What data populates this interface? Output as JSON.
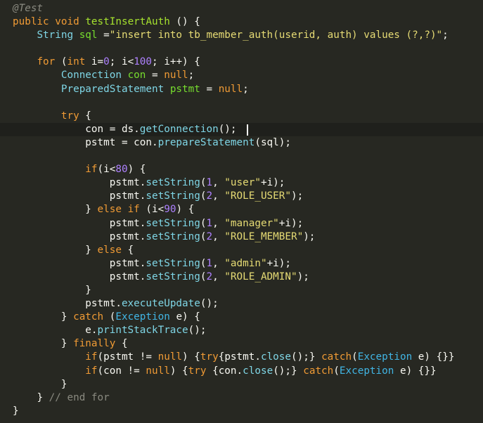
{
  "editor": {
    "lines": [
      [
        {
          "t": "@Test",
          "c": "c-anno"
        }
      ],
      [
        {
          "t": "public",
          "c": "c-kw"
        },
        {
          "t": " ",
          "c": "c-op"
        },
        {
          "t": "void",
          "c": "c-kw"
        },
        {
          "t": " ",
          "c": "c-op"
        },
        {
          "t": "testInsertAuth",
          "c": "c-methodname"
        },
        {
          "t": " () {",
          "c": "c-op"
        }
      ],
      [
        {
          "t": "    ",
          "c": "c-op"
        },
        {
          "t": "String",
          "c": "c-classname"
        },
        {
          "t": " ",
          "c": "c-op"
        },
        {
          "t": "sql",
          "c": "c-type"
        },
        {
          "t": " =",
          "c": "c-op"
        },
        {
          "t": "\"insert into tb_member_auth(userid, auth) values (?,?)\"",
          "c": "c-string"
        },
        {
          "t": ";",
          "c": "c-op"
        }
      ],
      [],
      [
        {
          "t": "    ",
          "c": "c-op"
        },
        {
          "t": "for",
          "c": "c-kw"
        },
        {
          "t": " (",
          "c": "c-op"
        },
        {
          "t": "int",
          "c": "c-kw"
        },
        {
          "t": " ",
          "c": "c-op"
        },
        {
          "t": "i",
          "c": "c-var"
        },
        {
          "t": "=",
          "c": "c-op"
        },
        {
          "t": "0",
          "c": "c-number"
        },
        {
          "t": "; ",
          "c": "c-op"
        },
        {
          "t": "i",
          "c": "c-var"
        },
        {
          "t": "<",
          "c": "c-op"
        },
        {
          "t": "100",
          "c": "c-number"
        },
        {
          "t": "; ",
          "c": "c-op"
        },
        {
          "t": "i",
          "c": "c-var"
        },
        {
          "t": "++) {",
          "c": "c-op"
        }
      ],
      [
        {
          "t": "        ",
          "c": "c-op"
        },
        {
          "t": "Connection",
          "c": "c-classname"
        },
        {
          "t": " ",
          "c": "c-op"
        },
        {
          "t": "con",
          "c": "c-type"
        },
        {
          "t": " = ",
          "c": "c-op"
        },
        {
          "t": "null",
          "c": "c-kw"
        },
        {
          "t": ";",
          "c": "c-op"
        }
      ],
      [
        {
          "t": "        ",
          "c": "c-op"
        },
        {
          "t": "PreparedStatement",
          "c": "c-classname"
        },
        {
          "t": " ",
          "c": "c-op"
        },
        {
          "t": "pstmt",
          "c": "c-type"
        },
        {
          "t": " = ",
          "c": "c-op"
        },
        {
          "t": "null",
          "c": "c-kw"
        },
        {
          "t": ";",
          "c": "c-op"
        }
      ],
      [],
      [
        {
          "t": "        ",
          "c": "c-op"
        },
        {
          "t": "try",
          "c": "c-kw"
        },
        {
          "t": " {",
          "c": "c-op"
        }
      ],
      [
        {
          "t": "            ",
          "c": "c-op"
        },
        {
          "t": "con",
          "c": "c-var"
        },
        {
          "t": " = ",
          "c": "c-op"
        },
        {
          "t": "ds",
          "c": "c-var"
        },
        {
          "t": ".",
          "c": "c-op"
        },
        {
          "t": "getConnection",
          "c": "c-method"
        },
        {
          "t": "();",
          "c": "c-op"
        }
      ],
      [
        {
          "t": "            ",
          "c": "c-op"
        },
        {
          "t": "pstmt",
          "c": "c-var"
        },
        {
          "t": " = ",
          "c": "c-op"
        },
        {
          "t": "con",
          "c": "c-var"
        },
        {
          "t": ".",
          "c": "c-op"
        },
        {
          "t": "prepareStatement",
          "c": "c-method"
        },
        {
          "t": "(",
          "c": "c-op"
        },
        {
          "t": "sql",
          "c": "c-var"
        },
        {
          "t": ");",
          "c": "c-op"
        }
      ],
      [],
      [
        {
          "t": "            ",
          "c": "c-op"
        },
        {
          "t": "if",
          "c": "c-kw"
        },
        {
          "t": "(",
          "c": "c-op"
        },
        {
          "t": "i",
          "c": "c-var"
        },
        {
          "t": "<",
          "c": "c-op"
        },
        {
          "t": "80",
          "c": "c-number"
        },
        {
          "t": ") {",
          "c": "c-op"
        }
      ],
      [
        {
          "t": "                ",
          "c": "c-op"
        },
        {
          "t": "pstmt",
          "c": "c-var"
        },
        {
          "t": ".",
          "c": "c-op"
        },
        {
          "t": "setString",
          "c": "c-method"
        },
        {
          "t": "(",
          "c": "c-op"
        },
        {
          "t": "1",
          "c": "c-number"
        },
        {
          "t": ", ",
          "c": "c-op"
        },
        {
          "t": "\"user\"",
          "c": "c-string"
        },
        {
          "t": "+",
          "c": "c-op"
        },
        {
          "t": "i",
          "c": "c-var"
        },
        {
          "t": ");",
          "c": "c-op"
        }
      ],
      [
        {
          "t": "                ",
          "c": "c-op"
        },
        {
          "t": "pstmt",
          "c": "c-var"
        },
        {
          "t": ".",
          "c": "c-op"
        },
        {
          "t": "setString",
          "c": "c-method"
        },
        {
          "t": "(",
          "c": "c-op"
        },
        {
          "t": "2",
          "c": "c-number"
        },
        {
          "t": ", ",
          "c": "c-op"
        },
        {
          "t": "\"ROLE_USER\"",
          "c": "c-string"
        },
        {
          "t": ");",
          "c": "c-op"
        }
      ],
      [
        {
          "t": "            ",
          "c": "c-op"
        },
        {
          "t": "} ",
          "c": "c-op"
        },
        {
          "t": "else",
          "c": "c-kw"
        },
        {
          "t": " ",
          "c": "c-op"
        },
        {
          "t": "if",
          "c": "c-kw"
        },
        {
          "t": " (",
          "c": "c-op"
        },
        {
          "t": "i",
          "c": "c-var"
        },
        {
          "t": "<",
          "c": "c-op"
        },
        {
          "t": "90",
          "c": "c-number"
        },
        {
          "t": ") {",
          "c": "c-op"
        }
      ],
      [
        {
          "t": "                ",
          "c": "c-op"
        },
        {
          "t": "pstmt",
          "c": "c-var"
        },
        {
          "t": ".",
          "c": "c-op"
        },
        {
          "t": "setString",
          "c": "c-method"
        },
        {
          "t": "(",
          "c": "c-op"
        },
        {
          "t": "1",
          "c": "c-number"
        },
        {
          "t": ", ",
          "c": "c-op"
        },
        {
          "t": "\"manager\"",
          "c": "c-string"
        },
        {
          "t": "+",
          "c": "c-op"
        },
        {
          "t": "i",
          "c": "c-var"
        },
        {
          "t": ");",
          "c": "c-op"
        }
      ],
      [
        {
          "t": "                ",
          "c": "c-op"
        },
        {
          "t": "pstmt",
          "c": "c-var"
        },
        {
          "t": ".",
          "c": "c-op"
        },
        {
          "t": "setString",
          "c": "c-method"
        },
        {
          "t": "(",
          "c": "c-op"
        },
        {
          "t": "2",
          "c": "c-number"
        },
        {
          "t": ", ",
          "c": "c-op"
        },
        {
          "t": "\"ROLE_MEMBER\"",
          "c": "c-string"
        },
        {
          "t": ");",
          "c": "c-op"
        }
      ],
      [
        {
          "t": "            ",
          "c": "c-op"
        },
        {
          "t": "} ",
          "c": "c-op"
        },
        {
          "t": "else",
          "c": "c-kw"
        },
        {
          "t": " {",
          "c": "c-op"
        }
      ],
      [
        {
          "t": "                ",
          "c": "c-op"
        },
        {
          "t": "pstmt",
          "c": "c-var"
        },
        {
          "t": ".",
          "c": "c-op"
        },
        {
          "t": "setString",
          "c": "c-method"
        },
        {
          "t": "(",
          "c": "c-op"
        },
        {
          "t": "1",
          "c": "c-number"
        },
        {
          "t": ", ",
          "c": "c-op"
        },
        {
          "t": "\"admin\"",
          "c": "c-string"
        },
        {
          "t": "+",
          "c": "c-op"
        },
        {
          "t": "i",
          "c": "c-var"
        },
        {
          "t": ");",
          "c": "c-op"
        }
      ],
      [
        {
          "t": "                ",
          "c": "c-op"
        },
        {
          "t": "pstmt",
          "c": "c-var"
        },
        {
          "t": ".",
          "c": "c-op"
        },
        {
          "t": "setString",
          "c": "c-method"
        },
        {
          "t": "(",
          "c": "c-op"
        },
        {
          "t": "2",
          "c": "c-number"
        },
        {
          "t": ", ",
          "c": "c-op"
        },
        {
          "t": "\"ROLE_ADMIN\"",
          "c": "c-string"
        },
        {
          "t": ");",
          "c": "c-op"
        }
      ],
      [
        {
          "t": "            ",
          "c": "c-op"
        },
        {
          "t": "}",
          "c": "c-op"
        }
      ],
      [
        {
          "t": "            ",
          "c": "c-op"
        },
        {
          "t": "pstmt",
          "c": "c-var"
        },
        {
          "t": ".",
          "c": "c-op"
        },
        {
          "t": "executeUpdate",
          "c": "c-method"
        },
        {
          "t": "();",
          "c": "c-op"
        }
      ],
      [
        {
          "t": "        ",
          "c": "c-op"
        },
        {
          "t": "} ",
          "c": "c-op"
        },
        {
          "t": "catch",
          "c": "c-kw"
        },
        {
          "t": " (",
          "c": "c-op"
        },
        {
          "t": "Exception",
          "c": "c-ex"
        },
        {
          "t": " ",
          "c": "c-op"
        },
        {
          "t": "e",
          "c": "c-var"
        },
        {
          "t": ") {",
          "c": "c-op"
        }
      ],
      [
        {
          "t": "            ",
          "c": "c-op"
        },
        {
          "t": "e",
          "c": "c-var"
        },
        {
          "t": ".",
          "c": "c-op"
        },
        {
          "t": "printStackTrace",
          "c": "c-method"
        },
        {
          "t": "();",
          "c": "c-op"
        }
      ],
      [
        {
          "t": "        ",
          "c": "c-op"
        },
        {
          "t": "} ",
          "c": "c-op"
        },
        {
          "t": "finally",
          "c": "c-kw"
        },
        {
          "t": " {",
          "c": "c-op"
        }
      ],
      [
        {
          "t": "            ",
          "c": "c-op"
        },
        {
          "t": "if",
          "c": "c-kw"
        },
        {
          "t": "(",
          "c": "c-op"
        },
        {
          "t": "pstmt",
          "c": "c-var"
        },
        {
          "t": " != ",
          "c": "c-op"
        },
        {
          "t": "null",
          "c": "c-kw"
        },
        {
          "t": ") {",
          "c": "c-op"
        },
        {
          "t": "try",
          "c": "c-kw"
        },
        {
          "t": "{",
          "c": "c-op"
        },
        {
          "t": "pstmt",
          "c": "c-var"
        },
        {
          "t": ".",
          "c": "c-op"
        },
        {
          "t": "close",
          "c": "c-method"
        },
        {
          "t": "();} ",
          "c": "c-op"
        },
        {
          "t": "catch",
          "c": "c-kw"
        },
        {
          "t": "(",
          "c": "c-op"
        },
        {
          "t": "Exception",
          "c": "c-ex"
        },
        {
          "t": " ",
          "c": "c-op"
        },
        {
          "t": "e",
          "c": "c-var"
        },
        {
          "t": ") {}}",
          "c": "c-op"
        }
      ],
      [
        {
          "t": "            ",
          "c": "c-op"
        },
        {
          "t": "if",
          "c": "c-kw"
        },
        {
          "t": "(",
          "c": "c-op"
        },
        {
          "t": "con",
          "c": "c-var"
        },
        {
          "t": " != ",
          "c": "c-op"
        },
        {
          "t": "null",
          "c": "c-kw"
        },
        {
          "t": ") {",
          "c": "c-op"
        },
        {
          "t": "try",
          "c": "c-kw"
        },
        {
          "t": " {",
          "c": "c-op"
        },
        {
          "t": "con",
          "c": "c-var"
        },
        {
          "t": ".",
          "c": "c-op"
        },
        {
          "t": "close",
          "c": "c-method"
        },
        {
          "t": "();} ",
          "c": "c-op"
        },
        {
          "t": "catch",
          "c": "c-kw"
        },
        {
          "t": "(",
          "c": "c-op"
        },
        {
          "t": "Exception",
          "c": "c-ex"
        },
        {
          "t": " ",
          "c": "c-op"
        },
        {
          "t": "e",
          "c": "c-var"
        },
        {
          "t": ") {}}",
          "c": "c-op"
        }
      ],
      [
        {
          "t": "        ",
          "c": "c-op"
        },
        {
          "t": "}",
          "c": "c-op"
        }
      ],
      [
        {
          "t": "    ",
          "c": "c-op"
        },
        {
          "t": "} ",
          "c": "c-op"
        },
        {
          "t": "// end for",
          "c": "c-comment"
        }
      ],
      [
        {
          "t": "}",
          "c": "c-op"
        }
      ]
    ]
  }
}
